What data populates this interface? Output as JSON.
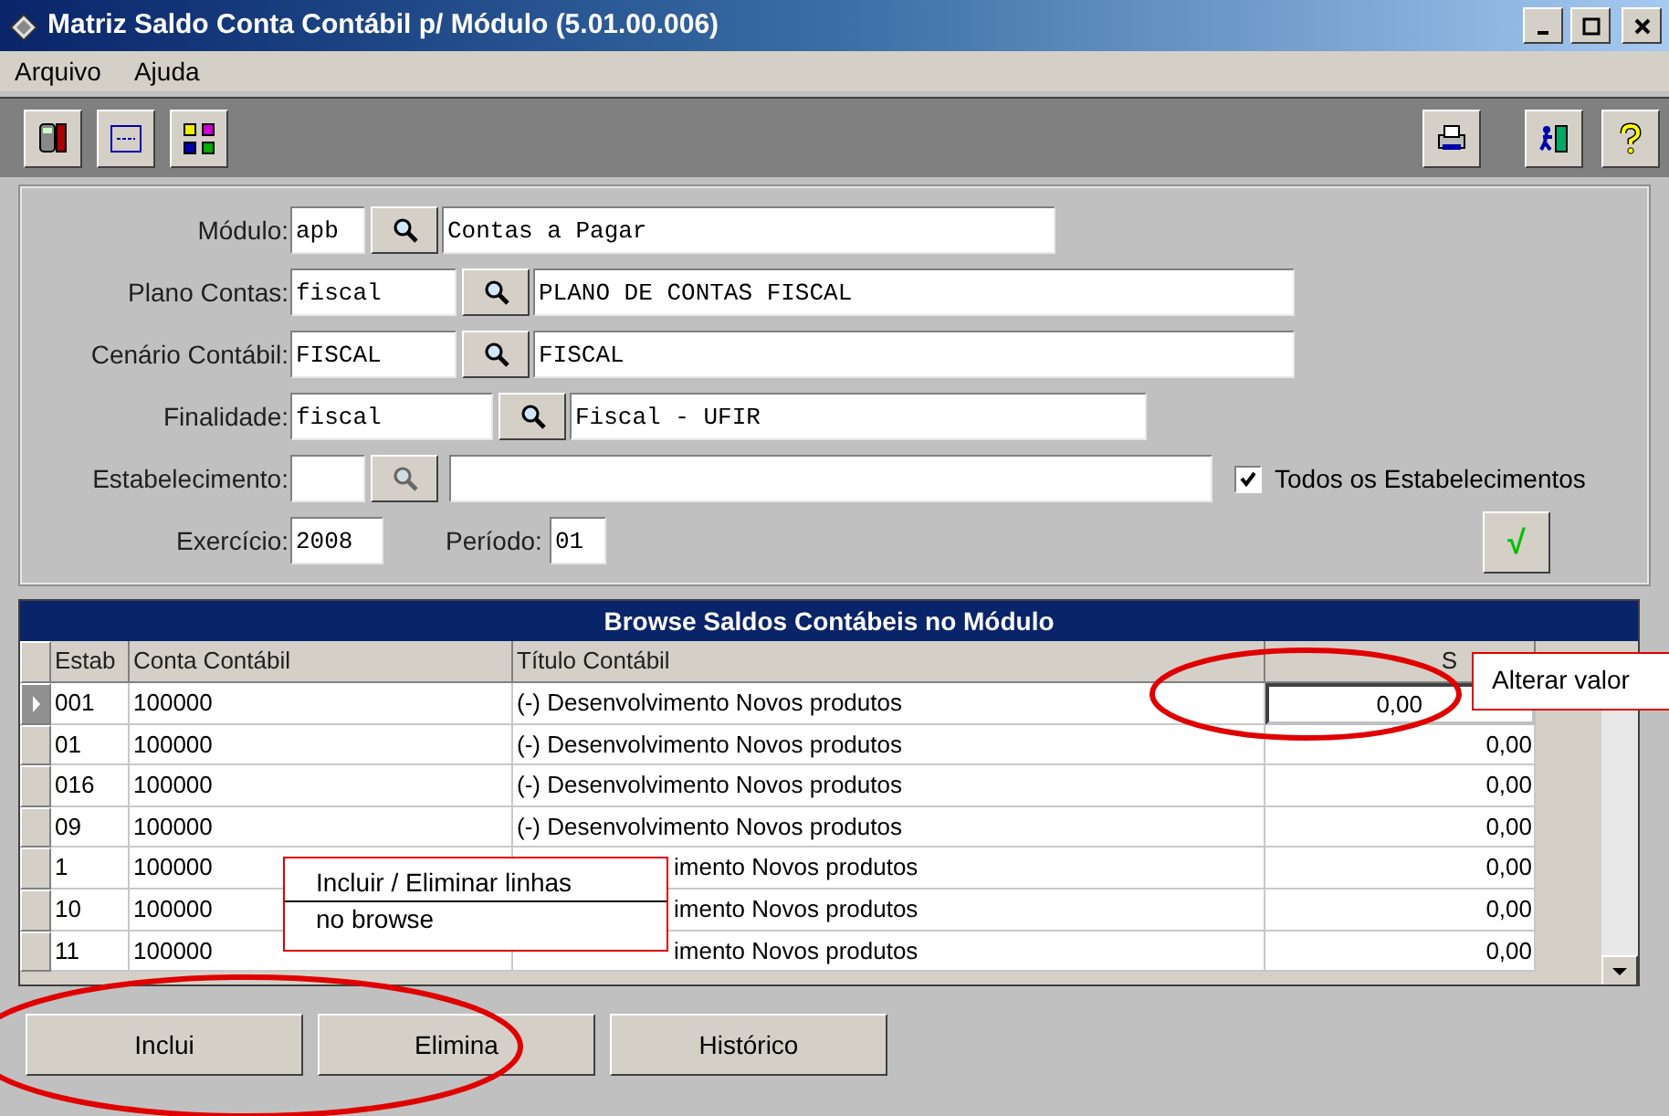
{
  "window": {
    "title": "Matriz Saldo Conta Contábil p/ Módulo (5.01.00.006)"
  },
  "menu": [
    "Arquivo",
    "Ajuda"
  ],
  "form": {
    "fields": [
      {
        "label": "Módulo:",
        "code": "apb",
        "description": "Contas a Pagar"
      },
      {
        "label": "Plano Contas:",
        "code": "fiscal",
        "description": "PLANO DE CONTAS FISCAL"
      },
      {
        "label": "Cenário Contábil:",
        "code": "FISCAL",
        "description": "FISCAL"
      },
      {
        "label": "Finalidade:",
        "code": "fiscal",
        "description": "Fiscal - UFIR"
      },
      {
        "label": "Estabelecimento:"
      }
    ],
    "all_establishments": {
      "label": "Todos os Estabelecimentos",
      "checked": true
    },
    "exercise": {
      "label": "Exercício:",
      "value": "2008"
    },
    "period": {
      "label": "Período:",
      "value": "01"
    },
    "confirm_button": "√"
  },
  "browse": {
    "title": "Browse Saldos Contábeis no Módulo",
    "columns": [
      "Estab",
      "Conta Contábil",
      "Título Contábil",
      "S"
    ],
    "rows": [
      {
        "estab": "001",
        "conta": "100000",
        "titulo": "(-) Desenvolvimento Novos produtos",
        "saldo": "0,00",
        "selected": true,
        "partly_covered": false
      },
      {
        "estab": "01",
        "conta": "100000",
        "titulo": "(-) Desenvolvimento Novos produtos",
        "saldo": "0,00",
        "selected": false,
        "partly_covered": false
      },
      {
        "estab": "016",
        "conta": "100000",
        "titulo": "(-) Desenvolvimento Novos produtos",
        "saldo": "0,00",
        "selected": false,
        "partly_covered": false
      },
      {
        "estab": "09",
        "conta": "100000",
        "titulo": "(-) Desenvolvimento Novos produtos",
        "saldo": "0,00",
        "selected": false,
        "partly_covered": false
      },
      {
        "estab": "1",
        "conta": "100000",
        "titulo": "imento Novos produtos",
        "saldo": "0,00",
        "selected": false,
        "partly_covered": true
      },
      {
        "estab": "10",
        "conta": "100000",
        "titulo": "imento Novos produtos",
        "saldo": "0,00",
        "selected": false,
        "partly_covered": true
      },
      {
        "estab": "11",
        "conta": "100000",
        "titulo": "imento Novos produtos",
        "saldo": "0,00",
        "selected": false,
        "partly_covered": true
      }
    ]
  },
  "buttons": [
    "Inclui",
    "Elimina",
    "Histórico"
  ],
  "callouts": [
    {
      "kind": "value",
      "lines": [
        "Alterar valor"
      ]
    },
    {
      "kind": "rows",
      "lines": [
        "Incluir / Eliminar linhas",
        "no browse"
      ]
    }
  ]
}
